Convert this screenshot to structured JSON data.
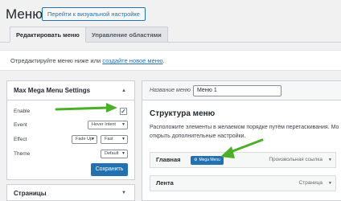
{
  "header": {
    "title": "Меню",
    "customize_button": "Перейти к визуальной настройке"
  },
  "tabs": [
    {
      "label": "Редактировать меню",
      "active": true
    },
    {
      "label": "Управление областями",
      "active": false
    }
  ],
  "notice": {
    "text": "Отредактируйте меню ниже или",
    "link": "создайте новое меню",
    "suffix": "."
  },
  "mega_panel": {
    "title": "Max Mega Menu Settings",
    "enable_label": "Enable",
    "enable_checked": true,
    "event_label": "Event",
    "event_value": "Hover Intent",
    "effect_label": "Effect",
    "effect_value": "Fade Up",
    "effect_speed": "Fast",
    "theme_label": "Theme",
    "theme_value": "Default",
    "save_button": "Сохранить"
  },
  "pages_panel": {
    "title": "Страницы"
  },
  "menu_editor": {
    "name_label": "Название меню",
    "name_value": "Меню 1",
    "structure_title": "Структура меню",
    "structure_desc": "Расположите элементы в желаемом порядке путём перетаскивания. Мо",
    "structure_desc2": "открыть дополнительные настройки.",
    "items": [
      {
        "label": "Главная",
        "type": "Произвольная ссылка",
        "badge": "Mega Menu"
      },
      {
        "label": "Лента",
        "type": "Страница"
      }
    ]
  },
  "colors": {
    "accent": "#2271b1",
    "arrow": "#4caf2a"
  }
}
